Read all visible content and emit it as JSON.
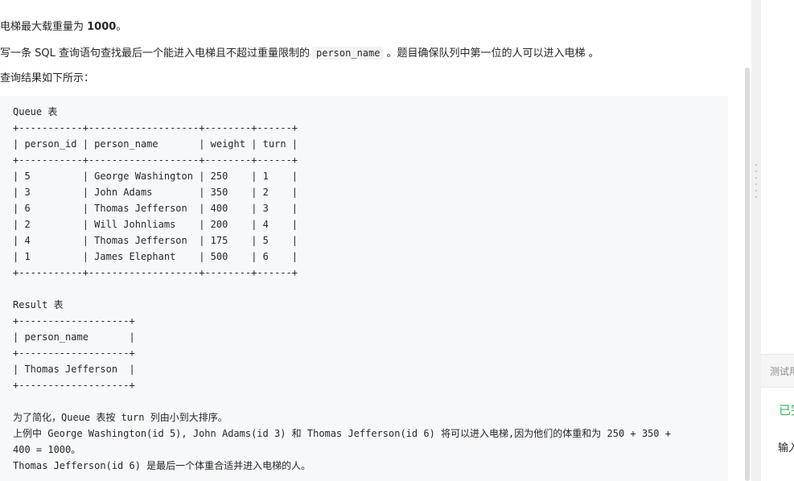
{
  "problem": {
    "p1_prefix": "电梯最大载重量为 ",
    "p1_bold": "1000",
    "p1_suffix": "。",
    "p2_prefix": "写一条 SQL 查询语句查找最后一个能进入电梯且不超过重量限制的",
    "p2_code": "person_name",
    "p2_suffix": "。题目确保队列中第一位的人可以进入电梯 。",
    "p3": "查询结果如下所示："
  },
  "example": {
    "lines": [
      "Queue 表",
      "+-----------+-------------------+--------+------+",
      "| person_id | person_name       | weight | turn |",
      "+-----------+-------------------+--------+------+",
      "| 5         | George Washington | 250    | 1    |",
      "| 3         | John Adams        | 350    | 2    |",
      "| 6         | Thomas Jefferson  | 400    | 3    |",
      "| 2         | Will Johnliams    | 200    | 4    |",
      "| 4         | Thomas Jefferson  | 175    | 5    |",
      "| 1         | James Elephant    | 500    | 6    |",
      "+-----------+-------------------+--------+------+",
      "",
      "Result 表",
      "+-------------------+",
      "| person_name       |",
      "+-------------------+",
      "| Thomas Jefferson  |",
      "+-------------------+",
      "",
      "为了简化，Queue 表按 turn 列由小到大排序。",
      "上例中 George Washington(id 5), John Adams(id 3) 和 Thomas Jefferson(id 6) 将可以进入电梯,因为他们的体重和为 250 + 350 +",
      "400 = 1000。",
      "Thomas Jefferson(id 6) 是最后一个体重合适并进入电梯的人。"
    ]
  },
  "right_panel": {
    "tab_label": "测试用",
    "status": "已完",
    "input_label": "输入"
  },
  "colors": {
    "text": "#262626",
    "code_bg": "#f7f8fa",
    "success": "#2db55d",
    "muted": "#8c8c8c"
  }
}
